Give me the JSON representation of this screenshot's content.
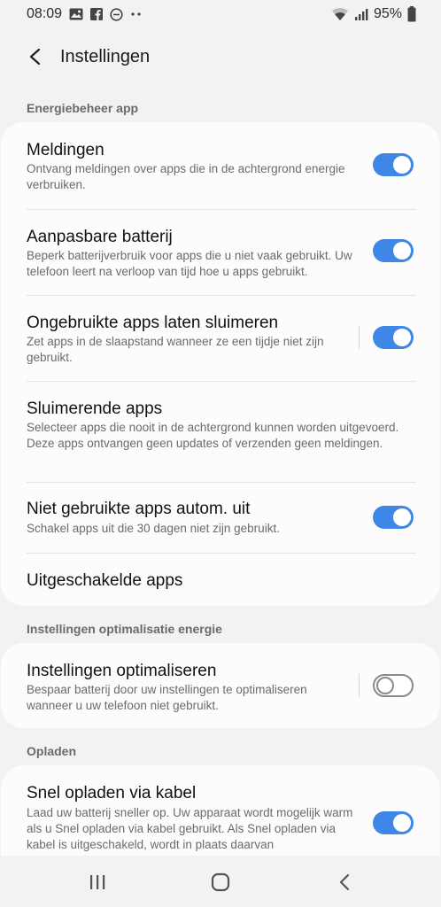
{
  "status": {
    "time": "08:09",
    "battery_pct": "95%",
    "left_icons": [
      "gallery-icon",
      "facebook-icon",
      "do-not-disturb-icon",
      "more-dots-icon"
    ],
    "right_icons": [
      "wifi-icon",
      "signal-icon",
      "battery-icon"
    ]
  },
  "header": {
    "title": "Instellingen",
    "back_icon": "back-arrow-icon"
  },
  "sections": {
    "energy": "Energiebeheer app",
    "optimization": "Instellingen optimalisatie energie",
    "charging": "Opladen"
  },
  "items": {
    "notifications": {
      "title": "Meldingen",
      "subtitle": "Ontvang meldingen over apps die in de achtergrond energie verbruiken.",
      "enabled": true
    },
    "adaptive": {
      "title": "Aanpasbare batterij",
      "subtitle": "Beperk batterijverbruik voor apps die u niet vaak gebruikt. Uw telefoon leert na verloop van tijd hoe u apps gebruikt.",
      "enabled": true
    },
    "sleep_unused": {
      "title": "Ongebruikte apps laten sluimeren",
      "subtitle": "Zet apps in de slaapstand wanneer ze een tijdje niet zijn gebruikt.",
      "enabled": true
    },
    "sleeping_apps": {
      "title": "Sluimerende apps",
      "subtitle": "Selecteer apps die nooit in de achtergrond kunnen worden uitgevoerd. Deze apps ontvangen geen updates of verzenden geen meldingen."
    },
    "auto_disable": {
      "title": "Niet gebruikte apps autom. uit",
      "subtitle": "Schakel apps uit die 30 dagen niet zijn gebruikt.",
      "enabled": true
    },
    "disabled_apps": {
      "title": "Uitgeschakelde apps"
    },
    "optimize": {
      "title": "Instellingen optimaliseren",
      "subtitle": "Bespaar batterij door uw instellingen te optimaliseren wanneer u uw telefoon niet gebruikt.",
      "enabled": false
    },
    "fast_cable": {
      "title": "Snel opladen via kabel",
      "subtitle": "Laad uw batterij sneller op. Uw apparaat wordt mogelijk warm als u Snel opladen via kabel gebruikt. Als Snel opladen via kabel is uitgeschakeld, wordt in plaats daarvan",
      "enabled": true
    }
  },
  "navbar": {
    "recents_icon": "recents-icon",
    "home_icon": "home-icon",
    "back_icon": "nav-back-icon"
  },
  "colors": {
    "accent": "#3e87e6",
    "background": "#f2f2f2",
    "card": "#fcfcfc"
  }
}
